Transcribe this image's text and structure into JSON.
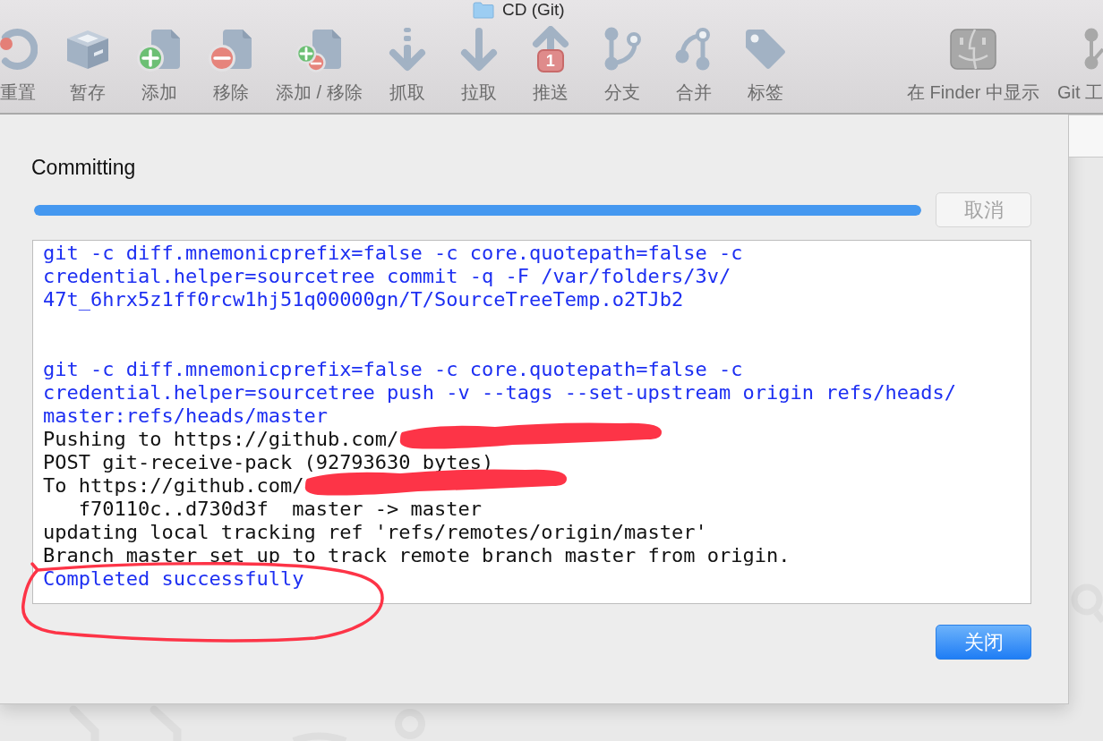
{
  "window": {
    "title": "CD (Git)"
  },
  "toolbar": {
    "items": [
      {
        "kind": "reset",
        "label": "重置"
      },
      {
        "kind": "stash",
        "label": "暂存"
      },
      {
        "kind": "add",
        "label": "添加"
      },
      {
        "kind": "remove",
        "label": "移除"
      },
      {
        "kind": "add-remove",
        "label": "添加 / 移除"
      },
      {
        "kind": "fetch",
        "label": "抓取"
      },
      {
        "kind": "pull",
        "label": "拉取"
      },
      {
        "kind": "push",
        "label": "推送",
        "badge": "1"
      },
      {
        "kind": "branch",
        "label": "分支"
      },
      {
        "kind": "merge",
        "label": "合并"
      },
      {
        "kind": "tag",
        "label": "标签"
      }
    ],
    "right_items": [
      {
        "kind": "finder",
        "label": "在 Finder 中显示"
      },
      {
        "kind": "git-flow",
        "label": "Git 工"
      }
    ]
  },
  "dialog": {
    "title": "Committing",
    "progress": {
      "level": 1
    },
    "cancel_button": {
      "label": "取消",
      "disabled": true
    },
    "log": [
      {
        "kind": "command",
        "circled": false,
        "lines": [
          {
            "text": "git -c diff.mnemonicprefix=false -c core.quotepath=false -c",
            "redacted": false
          },
          {
            "text": "credential.helper=sourcetree commit -q -F /var/folders/3v/",
            "redacted": false
          },
          {
            "text": "47t_6hrx5z1ff0rcw1hj51q00000gn/T/SourceTreeTemp.o2TJb2",
            "redacted": false
          }
        ]
      },
      {
        "kind": "command",
        "circled": false,
        "lines": [
          {
            "text": "git -c diff.mnemonicprefix=false -c core.quotepath=false -c",
            "redacted": false
          },
          {
            "text": "credential.helper=sourcetree push -v --tags --set-upstream origin refs/heads/",
            "redacted": false
          },
          {
            "text": "master:refs/heads/master",
            "redacted": false
          }
        ]
      },
      {
        "kind": "output",
        "circled": false,
        "lines": [
          {
            "text": "Pushing to https://github.com/",
            "redacted": true
          },
          {
            "text": "POST git-receive-pack (92793630 bytes)",
            "redacted": false
          },
          {
            "text": "To https://github.com/",
            "redacted": true
          },
          {
            "text": "   f70110c..d730d3f  master -> master",
            "redacted": false
          },
          {
            "text": "updating local tracking ref 'refs/remotes/origin/master'",
            "redacted": false
          },
          {
            "text": "Branch master set up to track remote branch master from origin.",
            "redacted": false
          }
        ]
      },
      {
        "kind": "status",
        "circled": true,
        "lines": [
          {
            "text": "Completed successfully",
            "redacted": false
          }
        ]
      }
    ],
    "close_button": {
      "label": "关闭",
      "default": true
    }
  }
}
